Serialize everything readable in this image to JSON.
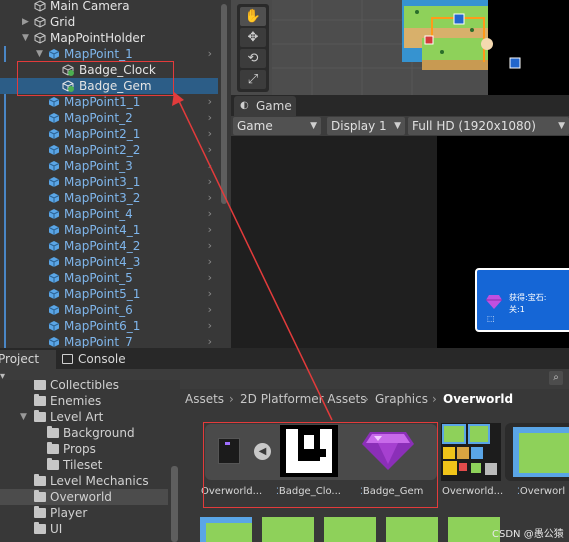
{
  "hierarchy": {
    "items": [
      {
        "label": "Main Camera"
      },
      {
        "label": "Grid"
      },
      {
        "label": "MapPointHolder"
      },
      {
        "label": "MapPoint_1"
      },
      {
        "label": "Badge_Clock"
      },
      {
        "label": "Badge_Gem"
      },
      {
        "label": "MapPoint1_1"
      },
      {
        "label": "MapPoint_2"
      },
      {
        "label": "MapPoint2_1"
      },
      {
        "label": "MapPoint2_2"
      },
      {
        "label": "MapPoint_3"
      },
      {
        "label": "MapPoint3_1"
      },
      {
        "label": "MapPoint3_2"
      },
      {
        "label": "MapPoint_4"
      },
      {
        "label": "MapPoint4_1"
      },
      {
        "label": "MapPoint4_2"
      },
      {
        "label": "MapPoint4_3"
      },
      {
        "label": "MapPoint_5"
      },
      {
        "label": "MapPoint5_1"
      },
      {
        "label": "MapPoint_6"
      },
      {
        "label": "MapPoint6_1"
      },
      {
        "label": "MapPoint_7"
      }
    ]
  },
  "game": {
    "tab_label": "Game",
    "display_mode": "Game",
    "display": "Display 1",
    "resolution": "Full HD (1920x1080)"
  },
  "bottom_tabs": {
    "project": "Project",
    "console": "Console"
  },
  "project_tree": {
    "items": [
      {
        "label": "Collectibles"
      },
      {
        "label": "Enemies"
      },
      {
        "label": "Level Art"
      },
      {
        "label": "Background"
      },
      {
        "label": "Props"
      },
      {
        "label": "Tileset"
      },
      {
        "label": "Level Mechanics"
      },
      {
        "label": "Overworld"
      },
      {
        "label": "Player"
      },
      {
        "label": "UI"
      }
    ]
  },
  "breadcrumb": [
    "Assets",
    "2D Platformer Assets",
    "Graphics",
    "Overworld"
  ],
  "assets": [
    {
      "label": "Overworld..."
    },
    {
      "label": "Badge_Clo..."
    },
    {
      "label": "Badge_Gem"
    },
    {
      "label": "Overworld..."
    },
    {
      "label": "Overworl"
    }
  ],
  "game_popup": {
    "line1": "获得:宝石:",
    "line2": "关:1"
  },
  "watermark": "CSDN @愚公猿",
  "colors": {
    "selection": "#2c5d87",
    "prefab_blue": "#7fb6ec",
    "annotation_red": "#e23b3b"
  }
}
